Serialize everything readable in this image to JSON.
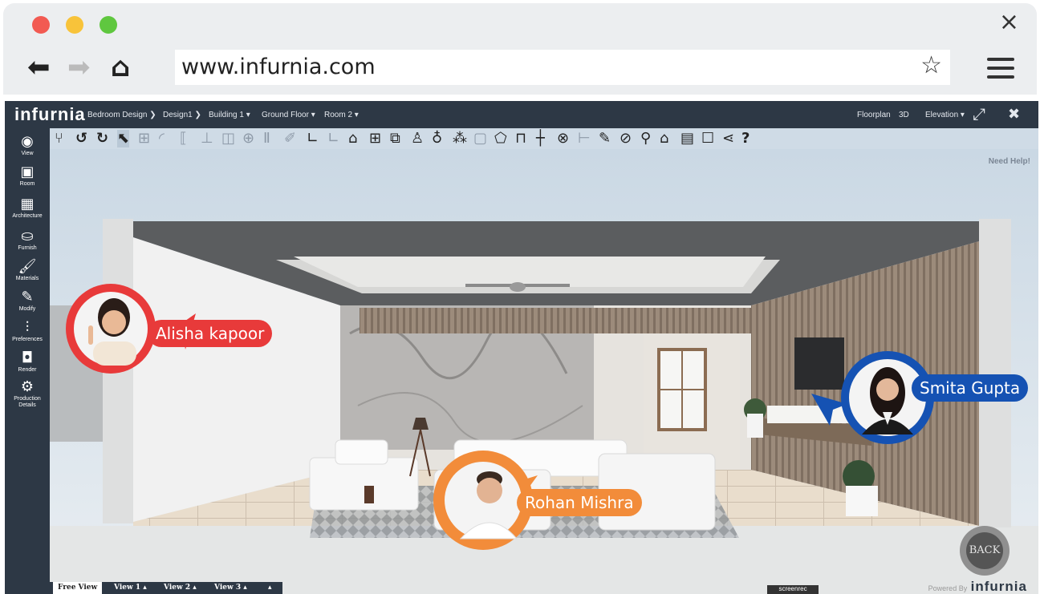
{
  "browser": {
    "url": "www.infurnia.com",
    "close_glyph": "×",
    "back_glyph": "⬅",
    "forward_glyph": "➡",
    "home_glyph": "⌂",
    "star_glyph": "☆"
  },
  "app": {
    "logo": "infurnia",
    "breadcrumb": [
      "Bedroom Design ❯",
      "Design1 ❯",
      "Building 1 ▾",
      "Ground Floor ▾",
      "Room 2 ▾"
    ],
    "right": {
      "floorplan": "Floorplan",
      "three_d": "3D",
      "elevation": "Elevation ▾",
      "expand": "⤢",
      "close": "✖"
    },
    "need_help": "Need Help!",
    "sidebar": [
      {
        "icon": "eye-icon",
        "glyph": "◉",
        "label": "View"
      },
      {
        "icon": "room-icon",
        "glyph": "▣",
        "label": "Room"
      },
      {
        "icon": "brick-icon",
        "glyph": "▦",
        "label": "Architecture"
      },
      {
        "icon": "sofa-icon",
        "glyph": "⛀",
        "label": "Furnish"
      },
      {
        "icon": "paint-brush-icon",
        "glyph": "🖌",
        "label": "Materials"
      },
      {
        "icon": "pencil-icon",
        "glyph": "✎",
        "label": "Modify"
      },
      {
        "icon": "sliders-icon",
        "glyph": "⫶",
        "label": "Preferences"
      },
      {
        "icon": "camera-icon",
        "glyph": "◘",
        "label": "Render"
      },
      {
        "icon": "gears-icon",
        "glyph": "⚙",
        "label": "Production Details"
      }
    ],
    "bottom_tabs": [
      "Free View",
      "View 1 ▴",
      "View 2 ▴",
      "View 3 ▴",
      "▴"
    ],
    "powered_by": "Powered By",
    "powered_logo": "infurnia",
    "recorder": "screenrec",
    "back_button": "BACK"
  },
  "collaborators": [
    {
      "name": "Alisha kapoor",
      "color": "#e83a3a"
    },
    {
      "name": "Smita Gupta",
      "color": "#1552b3"
    },
    {
      "name": "Rohan Mishra",
      "color": "#f28c3a"
    }
  ],
  "colors": {
    "topbar": "#2d3845",
    "toolbar": "#cfdbe6"
  }
}
